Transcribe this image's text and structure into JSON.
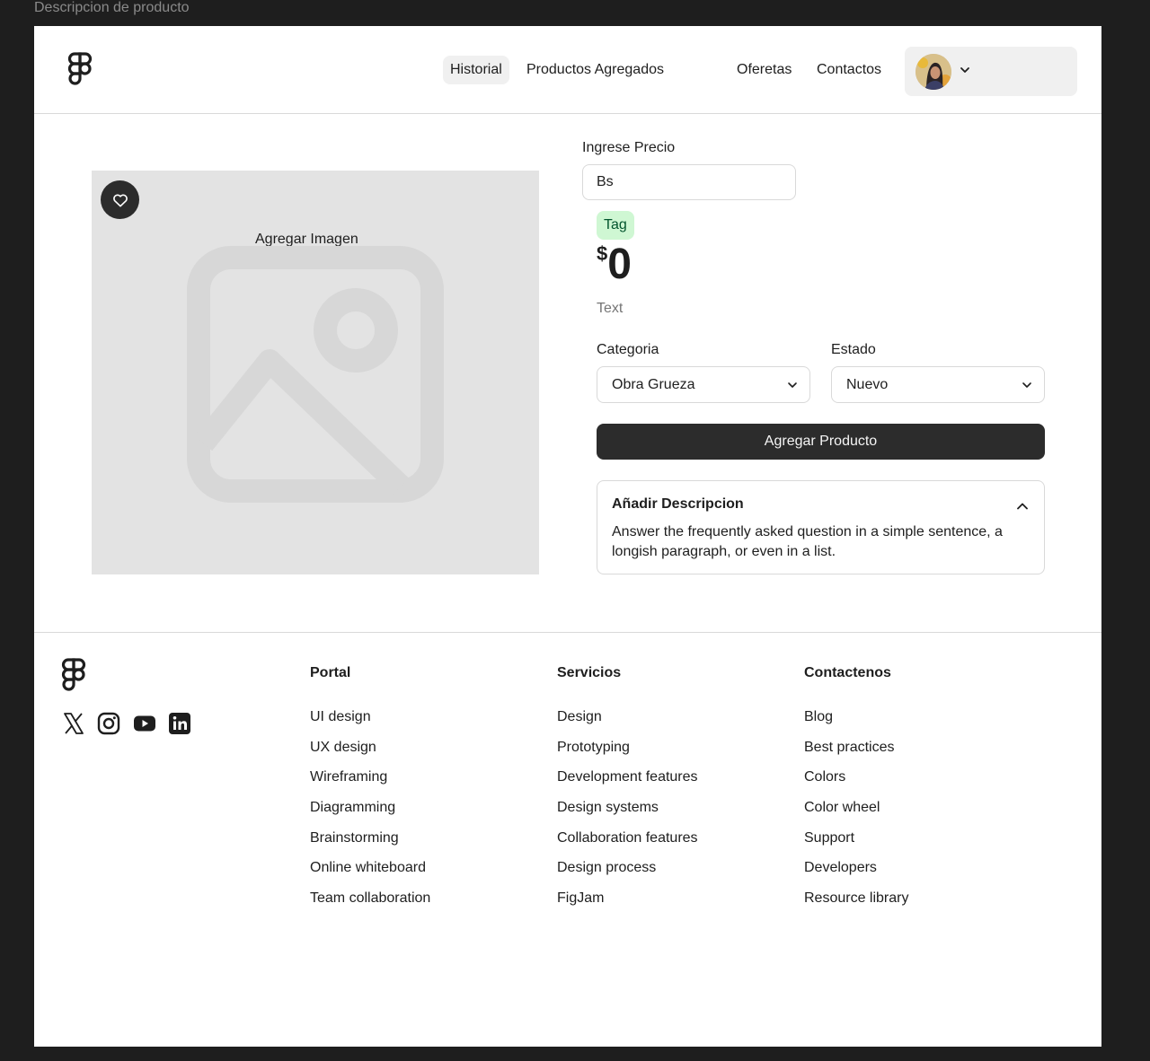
{
  "frame": {
    "label": "Descripcion de producto"
  },
  "header": {
    "nav": [
      {
        "label": "Historial",
        "active": true
      },
      {
        "label": "Productos Agregados",
        "active": false
      },
      {
        "label": "Oferetas",
        "active": false
      },
      {
        "label": "Contactos",
        "active": false
      }
    ],
    "icons": {
      "logo": "figma-logo-icon",
      "user_menu": "chevron-down-icon"
    }
  },
  "product": {
    "image_label": "Agregar Imagen",
    "favorite_icon": "heart-icon",
    "price_label": "Ingrese Precio",
    "price_input_value": "Bs",
    "tag": "Tag",
    "currency_symbol": "$",
    "price_value": "0",
    "text": "Text",
    "category_label": "Categoria",
    "category_value": "Obra Grueza",
    "status_label": "Estado",
    "status_value": "Nuevo",
    "add_button": "Agregar Producto",
    "description": {
      "title": "Añadir Descripcion",
      "body": "Answer the frequently asked question in a simple sentence, a longish paragraph, or even in a list.",
      "expanded": true
    }
  },
  "footer": {
    "social": [
      "x-icon",
      "instagram-icon",
      "youtube-icon",
      "linkedin-icon"
    ],
    "columns": [
      {
        "title": "Portal",
        "links": [
          "UI design",
          "UX design",
          "Wireframing",
          "Diagramming",
          "Brainstorming",
          "Online whiteboard",
          "Team collaboration"
        ]
      },
      {
        "title": "Servicios",
        "links": [
          "Design",
          "Prototyping",
          "Development features",
          "Design systems",
          "Collaboration features",
          "Design process",
          "FigJam"
        ]
      },
      {
        "title": "Contactenos",
        "links": [
          "Blog",
          "Best practices",
          "Colors",
          "Color wheel",
          "Support",
          "Developers",
          "Resource library"
        ]
      }
    ]
  },
  "colors": {
    "primary": "#2c2c2c",
    "tag_bg": "#cff7d3",
    "tag_text": "#02542d",
    "border": "#d9d9d9",
    "placeholder_bg": "#e3e3e3"
  }
}
